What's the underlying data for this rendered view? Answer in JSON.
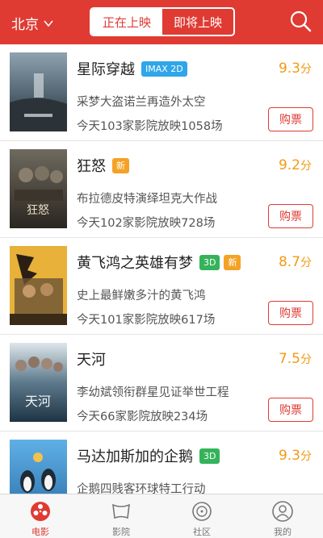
{
  "header": {
    "city": "北京",
    "tabs": {
      "now_showing": "正在上映",
      "coming_soon": "即将上映"
    }
  },
  "colors": {
    "brand": "#df3b33",
    "score": "#f39a12",
    "imax": "#2ea6e9",
    "new": "#f4a226",
    "3d": "#35b35a"
  },
  "movies": [
    {
      "title": "星际穿越",
      "badges": [
        "IMAX 2D"
      ],
      "score": "9.3",
      "tagline": "采梦大盗诺兰再造外太空",
      "shows": "今天103家影院放映1058场",
      "buy": "购票"
    },
    {
      "title": "狂怒",
      "badges": [
        "新"
      ],
      "score": "9.2",
      "tagline": "布拉德皮特演绎坦克大作战",
      "shows": "今天102家影院放映728场",
      "buy": "购票"
    },
    {
      "title": "黄飞鸿之英雄有梦",
      "badges": [
        "3D",
        "新"
      ],
      "score": "8.7",
      "tagline": "史上最鲜嫩多汁的黄飞鸿",
      "shows": "今天101家影院放映617场",
      "buy": "购票"
    },
    {
      "title": "天河",
      "badges": [],
      "score": "7.5",
      "tagline": "李幼斌领衔群星见证举世工程",
      "shows": "今天66家影院放映234场",
      "buy": "购票"
    },
    {
      "title": "马达加斯加的企鹅",
      "badges": [
        "3D"
      ],
      "score": "9.3",
      "tagline": "企鹅四贱客环球特工行动",
      "shows": "",
      "buy": ""
    }
  ],
  "score_unit": "分",
  "tabbar": {
    "movie": "电影",
    "cinema": "影院",
    "community": "社区",
    "mine": "我的"
  }
}
